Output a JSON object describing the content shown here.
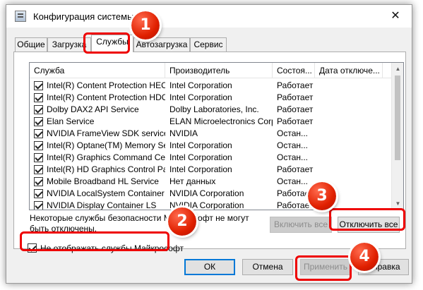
{
  "window": {
    "title": "Конфигурация системы",
    "close_glyph": "✕"
  },
  "tabs": [
    {
      "label": "Общие",
      "active": false
    },
    {
      "label": "Загрузка",
      "active": false
    },
    {
      "label": "Службы",
      "active": true
    },
    {
      "label": "Автозагрузка",
      "active": false
    },
    {
      "label": "Сервис",
      "active": false
    }
  ],
  "services": {
    "columns": [
      "Служба",
      "Производитель",
      "Состоя...",
      "Дата отключе..."
    ],
    "rows": [
      {
        "checked": true,
        "name": "Intel(R) Content Protection HEC...",
        "maker": "Intel Corporation",
        "status": "Работает",
        "date": ""
      },
      {
        "checked": true,
        "name": "Intel(R) Content Protection HDC...",
        "maker": "Intel Corporation",
        "status": "Работает",
        "date": ""
      },
      {
        "checked": true,
        "name": "Dolby DAX2 API Service",
        "maker": "Dolby Laboratories, Inc.",
        "status": "Работает",
        "date": ""
      },
      {
        "checked": true,
        "name": "Elan Service",
        "maker": "ELAN Microelectronics Corp",
        "status": "Работает",
        "date": ""
      },
      {
        "checked": true,
        "name": "NVIDIA FrameView SDK service",
        "maker": "NVIDIA",
        "status": "Остан...",
        "date": ""
      },
      {
        "checked": true,
        "name": "Intel(R) Optane(TM) Memory Se...",
        "maker": "Intel Corporation",
        "status": "Остан...",
        "date": ""
      },
      {
        "checked": true,
        "name": "Intel(R) Graphics Command Cen...",
        "maker": "Intel Corporation",
        "status": "Остан...",
        "date": ""
      },
      {
        "checked": true,
        "name": "Intel(R) HD Graphics Control Pa...",
        "maker": "Intel Corporation",
        "status": "Работает",
        "date": ""
      },
      {
        "checked": true,
        "name": "Mobile Broadband HL Service",
        "maker": "Нет данных",
        "status": "Остан...",
        "date": ""
      },
      {
        "checked": true,
        "name": "NVIDIA LocalSystem Container",
        "maker": "NVIDIA Corporation",
        "status": "Работает",
        "date": ""
      },
      {
        "checked": true,
        "name": "NVIDIA Display Container LS",
        "maker": "NVIDIA Corporation",
        "status": "Работает",
        "date": ""
      }
    ]
  },
  "note_text": "Некоторые службы безопасности Майкрософт не могут быть отключены.",
  "buttons": {
    "enable_all": "Включить все",
    "disable_all": "Отключить все",
    "ok": "ОК",
    "cancel": "Отмена",
    "apply": "Применить",
    "help": "Справка"
  },
  "hide_ms": {
    "label": "Не отображать службы Майкрософт",
    "checked": true
  },
  "annotations": [
    "1",
    "2",
    "3",
    "4"
  ],
  "colors": {
    "highlight": "#ee0000",
    "badge": "#e02000",
    "focus_border": "#0078d7"
  }
}
